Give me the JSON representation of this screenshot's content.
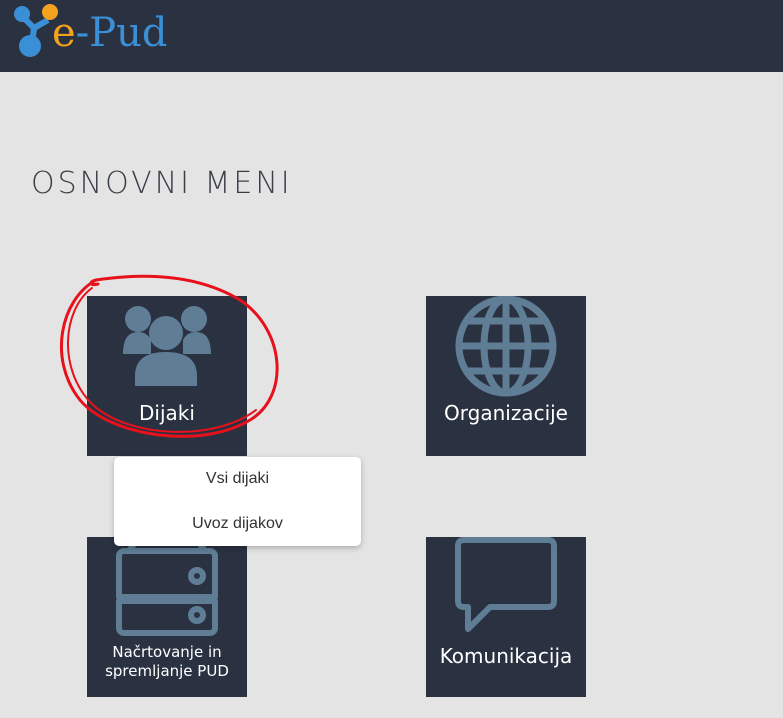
{
  "header": {
    "logo": {
      "text_e": "e",
      "text_rest": "-Pud"
    }
  },
  "main": {
    "title": "OSNOVNI MENI",
    "tiles": [
      {
        "label": "Dijaki",
        "icon": "users-icon"
      },
      {
        "label": "Organizacije",
        "icon": "globe-icon"
      },
      {
        "label_line1": "Načrtovanje in",
        "label_line2": "spremljanje PUD",
        "icon": "server-icon"
      },
      {
        "label": "Komunikacija",
        "icon": "speech-bubble-icon"
      }
    ],
    "dropdown": {
      "items": [
        {
          "label": "Vsi dijaki"
        },
        {
          "label": "Uvoz dijakov"
        }
      ]
    }
  },
  "colors": {
    "header_bg": "#2a3242",
    "tile_bg": "#2a3242",
    "icon_color": "#5f7e96",
    "page_bg": "#e4e4e4",
    "logo_orange": "#f4a11e",
    "logo_blue": "#3b8fd6",
    "annotation_red": "#e8101a"
  }
}
